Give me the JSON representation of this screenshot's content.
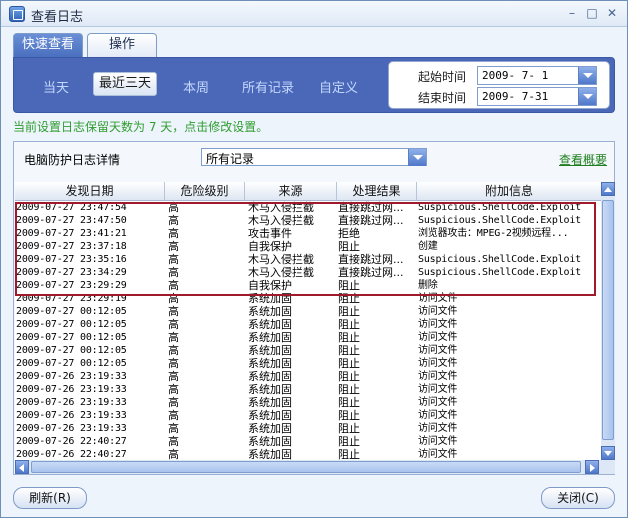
{
  "window": {
    "title": "查看日志",
    "minimize_glyph": "–",
    "maximize_glyph": "□",
    "close_glyph": "✕"
  },
  "tabs": [
    {
      "label": "快速查看",
      "active": true
    },
    {
      "label": "操作",
      "active": false
    }
  ],
  "ranges": {
    "today": "当天",
    "recent3": "最近三天",
    "week": "本周",
    "all": "所有记录",
    "custom": "自定义",
    "selected": "最近三天"
  },
  "date_range": {
    "start_label": "起始时间",
    "start_value": "2009- 7- 1",
    "end_label": "结束时间",
    "end_value": "2009- 7-31"
  },
  "retention_notice": "当前设置日志保留天数为 7 天，点击修改设置。",
  "log_panel": {
    "title": "电脑防护日志详情",
    "filter_value": "所有记录",
    "summary_link": "查看概要"
  },
  "columns": [
    "发现日期",
    "危险级别",
    "来源",
    "处理结果",
    "附加信息"
  ],
  "rows": [
    [
      "2009-07-27 23:47:54",
      "高",
      "木马入侵拦截",
      "直接跳过网...",
      "Suspicious.ShellCode.Exploit"
    ],
    [
      "2009-07-27 23:47:50",
      "高",
      "木马入侵拦截",
      "直接跳过网...",
      "Suspicious.ShellCode.Exploit"
    ],
    [
      "2009-07-27 23:41:21",
      "高",
      "攻击事件",
      "拒绝",
      "浏览器攻击：MPEG-2视频远程..."
    ],
    [
      "2009-07-27 23:37:18",
      "高",
      "自我保护",
      "阻止",
      "创建"
    ],
    [
      "2009-07-27 23:35:16",
      "高",
      "木马入侵拦截",
      "直接跳过网...",
      "Suspicious.ShellCode.Exploit"
    ],
    [
      "2009-07-27 23:34:29",
      "高",
      "木马入侵拦截",
      "直接跳过网...",
      "Suspicious.ShellCode.Exploit"
    ],
    [
      "2009-07-27 23:29:29",
      "高",
      "自我保护",
      "阻止",
      "删除"
    ],
    [
      "2009-07-27 23:29:19",
      "高",
      "系统加固",
      "阻止",
      "访问文件"
    ],
    [
      "2009-07-27 00:12:05",
      "高",
      "系统加固",
      "阻止",
      "访问文件"
    ],
    [
      "2009-07-27 00:12:05",
      "高",
      "系统加固",
      "阻止",
      "访问文件"
    ],
    [
      "2009-07-27 00:12:05",
      "高",
      "系统加固",
      "阻止",
      "访问文件"
    ],
    [
      "2009-07-27 00:12:05",
      "高",
      "系统加固",
      "阻止",
      "访问文件"
    ],
    [
      "2009-07-27 00:12:05",
      "高",
      "系统加固",
      "阻止",
      "访问文件"
    ],
    [
      "2009-07-26 23:19:33",
      "高",
      "系统加固",
      "阻止",
      "访问文件"
    ],
    [
      "2009-07-26 23:19:33",
      "高",
      "系统加固",
      "阻止",
      "访问文件"
    ],
    [
      "2009-07-26 23:19:33",
      "高",
      "系统加固",
      "阻止",
      "访问文件"
    ],
    [
      "2009-07-26 23:19:33",
      "高",
      "系统加固",
      "阻止",
      "访问文件"
    ],
    [
      "2009-07-26 23:19:33",
      "高",
      "系统加固",
      "阻止",
      "访问文件"
    ],
    [
      "2009-07-26 22:40:27",
      "高",
      "系统加固",
      "阻止",
      "访问文件"
    ],
    [
      "2009-07-26 22:40:27",
      "高",
      "系统加固",
      "阻止",
      "访问文件"
    ]
  ],
  "buttons": {
    "refresh": "刷新(R)",
    "close": "关闭(C)"
  },
  "colors": {
    "accent_blue": "#4a68b7",
    "highlight_border": "#a11a2c",
    "notice_green": "#2e9d2e"
  }
}
